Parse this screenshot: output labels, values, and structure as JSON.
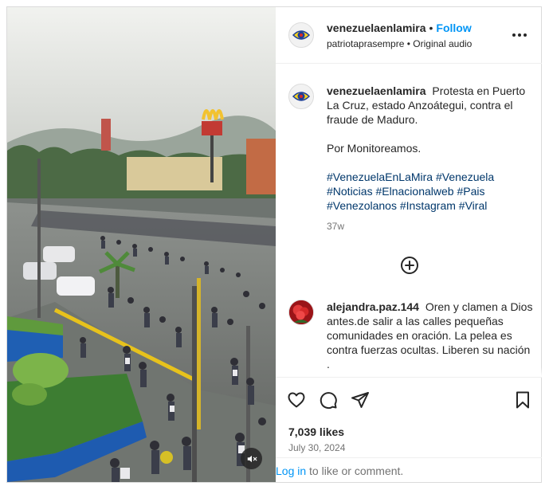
{
  "post": {
    "username": "venezuelaenlamira",
    "separator": "•",
    "follow_label": "Follow",
    "audio_user": "patriotaprasempre",
    "audio_label": "Original audio",
    "more_icon": "more-horizontal-icon"
  },
  "caption": {
    "username": "venezuelaenlamira",
    "text": "Protesta en Puerto La Cruz, estado Anzoátegui, contra el fraude de Maduro.",
    "text2": "Por Monitoreamos.",
    "hashtags": [
      "#VenezuelaEnLaMira",
      "#Venezuela",
      "#Noticias",
      "#Elnacionalweb",
      "#Pais",
      "#Venezolanos",
      "#Instagram",
      "#Viral"
    ],
    "time": "37w"
  },
  "load_more_icon": "plus-circle-icon",
  "comments": [
    {
      "username": "alejandra.paz.144",
      "text": "Oren y clamen a Dios antes.de salir a las calles pequeñas comunidades en oración. La pelea es contra fuerzas ocultas. Liberen su nación",
      "tail": "."
    }
  ],
  "actions": {
    "like_icon": "heart-icon",
    "comment_icon": "comment-icon",
    "share_icon": "share-icon",
    "save_icon": "bookmark-icon"
  },
  "likes": "7,039 likes",
  "date": "July 30, 2024",
  "login": {
    "link": "Log in",
    "rest": " to like or comment."
  },
  "media": {
    "mute_icon": "muted-speaker-icon"
  },
  "colors": {
    "link_blue": "#0095f6",
    "hashtag": "#00376b",
    "muted_text": "#737373",
    "border": "#dbdbdb"
  }
}
